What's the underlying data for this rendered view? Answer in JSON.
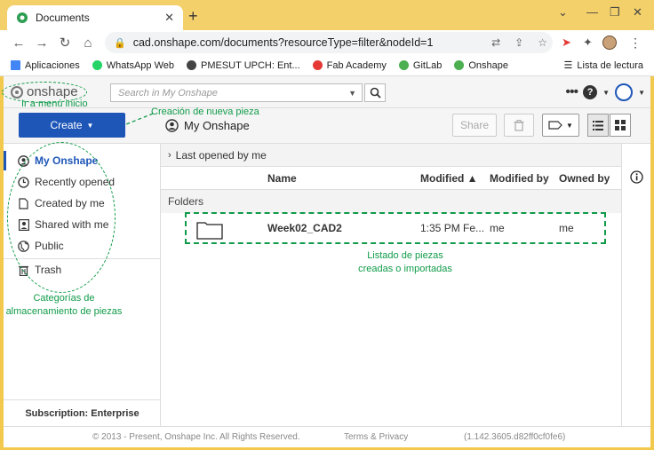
{
  "browser": {
    "tab_title": "Documents",
    "tab_close": "✕",
    "new_tab": "+",
    "url": "cad.onshape.com/documents?resourceType=filter&nodeId=1",
    "bookmarks": [
      {
        "label": "Aplicaciones",
        "color": "#4285f4"
      },
      {
        "label": "WhatsApp Web",
        "color": "#25d366"
      },
      {
        "label": "PMESUT UPCH: Ent...",
        "color": "#444444"
      },
      {
        "label": "Fab Academy",
        "color": "#e53935"
      },
      {
        "label": "GitLab",
        "color": "#4caf50"
      },
      {
        "label": "Onshape",
        "color": "#4caf50"
      }
    ],
    "reading_list": "Lista de lectura"
  },
  "app": {
    "logo_text": "onshape",
    "search_placeholder": "Search in My Onshape",
    "create_label": "Create",
    "location_title": "My Onshape",
    "share_label": "Share",
    "sidebar": {
      "items": [
        {
          "label": "My Onshape",
          "icon": "user-circle-icon",
          "active": true
        },
        {
          "label": "Recently opened",
          "icon": "clock-icon"
        },
        {
          "label": "Created by me",
          "icon": "document-icon"
        },
        {
          "label": "Shared with me",
          "icon": "shared-user-icon"
        },
        {
          "label": "Public",
          "icon": "globe-icon"
        },
        {
          "label": "Trash",
          "icon": "trash-icon"
        }
      ],
      "subscription": "Subscription: Enterprise"
    },
    "main": {
      "last_opened": "Last opened by me",
      "columns": {
        "name": "Name",
        "modified": "Modified ▲",
        "modified_by": "Modified by",
        "owned_by": "Owned by"
      },
      "folders_label": "Folders",
      "rows": [
        {
          "name": "Week02_CAD2",
          "modified": "1:35 PM Fe...",
          "modified_by": "me",
          "owned_by": "me"
        }
      ]
    },
    "footer": {
      "copyright": "© 2013 - Present, Onshape Inc. All Rights Reserved.",
      "terms": "Terms & Privacy",
      "version": "(1.142.3605.d82ff0cf0fe6)"
    }
  },
  "annotations": {
    "menu_inicio": "Ir a menú inicio",
    "nueva_pieza": "Creación de nueva pieza",
    "listado_1": "Listado de piezas",
    "listado_2": "creadas o importadas",
    "categorias_1": "Categorías de",
    "categorias_2": "almacenamiento de piezas"
  },
  "colors": {
    "accent": "#1e56b8",
    "annotation": "#109b49",
    "frame": "#f2c94c"
  }
}
